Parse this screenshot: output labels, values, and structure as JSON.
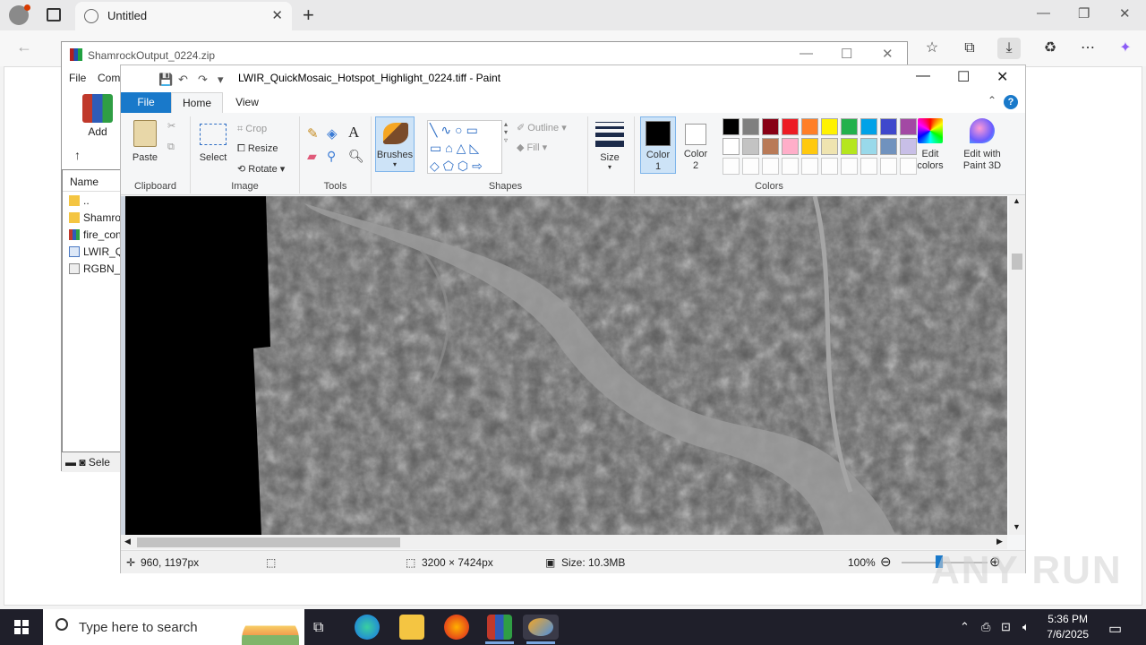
{
  "browser": {
    "tab_title": "Untitled",
    "newtab_label": "+"
  },
  "winrar": {
    "title": "ShamrockOutput_0224.zip",
    "menu": [
      "File",
      "Com"
    ],
    "add_label": "Add",
    "column_name": "Name",
    "files": [
      {
        "name": "..",
        "type": "folder"
      },
      {
        "name": "Shamro",
        "type": "folder"
      },
      {
        "name": "fire_con",
        "type": "archive"
      },
      {
        "name": "LWIR_Q",
        "type": "image"
      },
      {
        "name": "RGBN_C",
        "type": "image"
      }
    ],
    "status": "Sele"
  },
  "paint": {
    "title": "LWIR_QuickMosaic_Hotspot_Highlight_0224.tiff - Paint",
    "tabs": {
      "file": "File",
      "home": "Home",
      "view": "View"
    },
    "clipboard": {
      "paste": "Paste",
      "label": "Clipboard"
    },
    "image": {
      "select": "Select",
      "crop": "Crop",
      "resize": "Resize",
      "rotate": "Rotate",
      "label": "Image"
    },
    "tools": {
      "label": "Tools"
    },
    "brushes": "Brushes",
    "shapes": {
      "outline": "Outline",
      "fill": "Fill",
      "label": "Shapes"
    },
    "size": "Size",
    "color1": [
      "Color",
      "1"
    ],
    "color2": [
      "Color",
      "2"
    ],
    "colors_label": "Colors",
    "edit_colors": [
      "Edit",
      "colors"
    ],
    "edit_3d": [
      "Edit with",
      "Paint 3D"
    ],
    "palette_row1": [
      "#000000",
      "#7f7f7f",
      "#880015",
      "#ed1c24",
      "#ff7f27",
      "#fff200",
      "#22b14c",
      "#00a2e8",
      "#3f48cc",
      "#a349a4"
    ],
    "palette_row2": [
      "#ffffff",
      "#c3c3c3",
      "#b97a57",
      "#ffaec9",
      "#ffc90e",
      "#efe4b0",
      "#b5e61d",
      "#99d9ea",
      "#7092be",
      "#c8bfe7"
    ],
    "status": {
      "cursor": "960, 1197px",
      "dimensions": "3200 × 7424px",
      "size": "Size: 10.3MB",
      "zoom": "100%"
    }
  },
  "taskbar": {
    "search_placeholder": "Type here to search",
    "time": "5:36 PM",
    "date": "7/6/2025"
  },
  "watermark": "ANY RUN"
}
